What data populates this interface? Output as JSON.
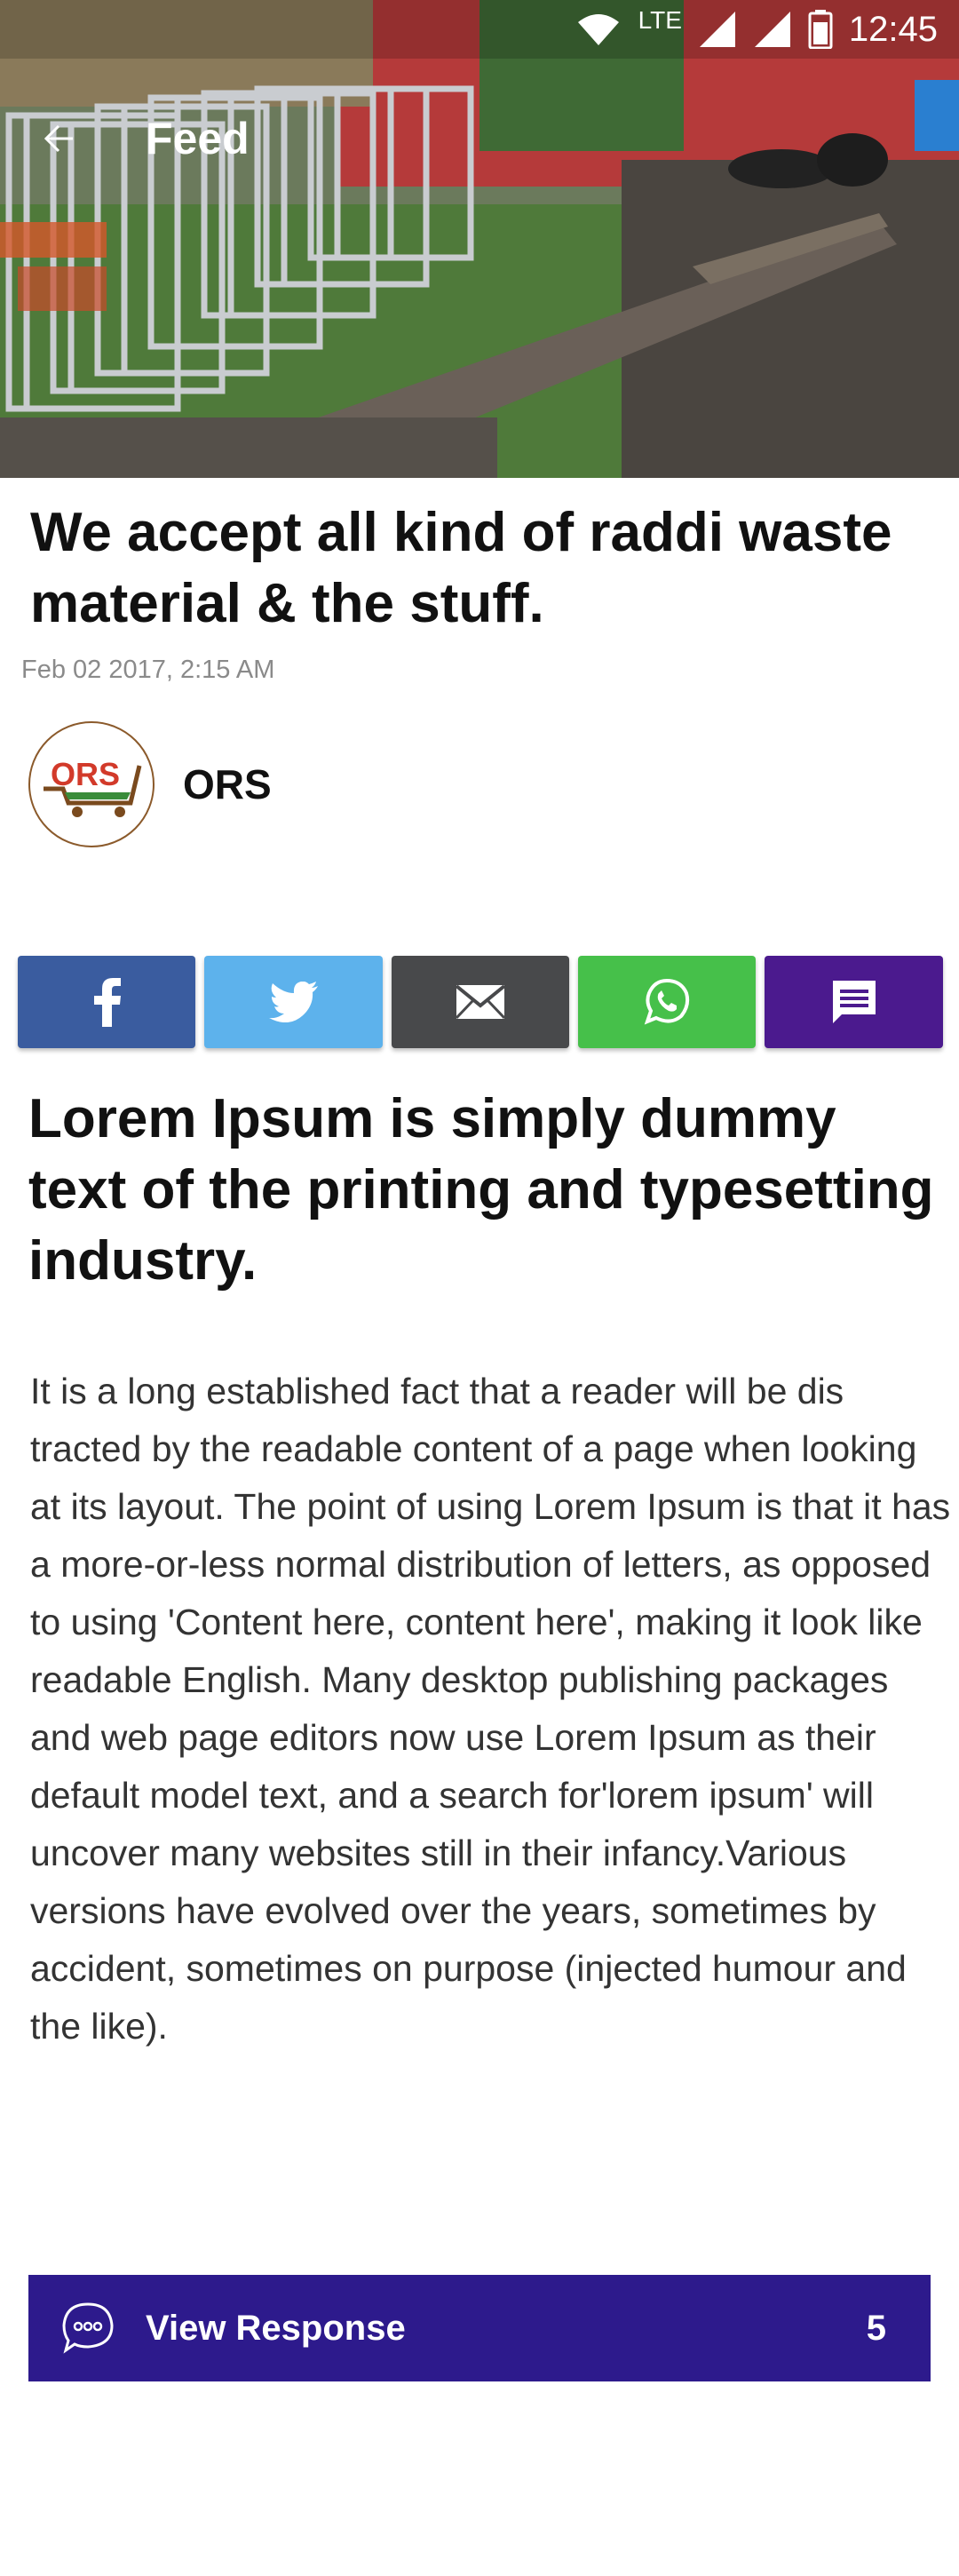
{
  "status_bar": {
    "network": "LTE",
    "time": "12:45"
  },
  "appbar": {
    "title": "Feed",
    "back_icon": "arrow-left-icon"
  },
  "article": {
    "title": "We accept all kind of raddi waste material & the stuff.",
    "date": "Feb 02 2017, 2:15 AM",
    "author": {
      "name": "ORS",
      "logo_text": "ORS"
    }
  },
  "share": [
    {
      "name": "facebook",
      "icon": "facebook-icon",
      "color": "#3a5c9f"
    },
    {
      "name": "twitter",
      "icon": "twitter-icon",
      "color": "#5db2ec"
    },
    {
      "name": "email",
      "icon": "email-icon",
      "color": "#48494b"
    },
    {
      "name": "whatsapp",
      "icon": "whatsapp-icon",
      "color": "#46c04a"
    },
    {
      "name": "comment",
      "icon": "comment-icon",
      "color": "#4b1a8e"
    }
  ],
  "content": {
    "heading": "Lorem Ipsum is simply dummy text of the printing and typesetting industry.",
    "body": "It is a long established fact that a reader will be dis tracted by the readable content of a page when looking at its layout. The point of using Lorem Ipsum is that it has a more-or-less normal distribution of letters, as opposed to using 'Content here, content here', making it look like readable English. Many desktop publishing packages and web page editors now use Lorem Ipsum as their default model text, and a search for'lorem ipsum' will uncover many websites still in their infancy.Various versions have evolved over the years, sometimes by accident, sometimes on purpose (injected humour and the like)."
  },
  "response": {
    "label": "View Response",
    "count": "5",
    "color": "#2d1a8c"
  }
}
